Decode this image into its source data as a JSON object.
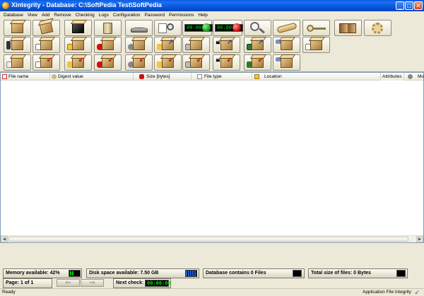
{
  "window": {
    "title": "Xintegrity  - Database: C:\\SoftPedia Test\\SoftPedia",
    "minimize_glyph": "_",
    "maximize_glyph": "□",
    "close_glyph": "✕"
  },
  "menu": [
    "Database",
    "View",
    "Add",
    "Remove",
    "Checking",
    "Logs",
    "Configuration",
    "Password",
    "Permissions",
    "Help"
  ],
  "toolbar": {
    "clock_left": "00:00:00",
    "clock_right": "00:00:00"
  },
  "columns": [
    {
      "label": "File name",
      "icon": "file-icon"
    },
    {
      "label": "Digest value",
      "icon": "key-icon"
    },
    {
      "label": "Size [bytes]",
      "icon": "size-icon"
    },
    {
      "label": "File type",
      "icon": "file-type-icon"
    },
    {
      "label": "Location",
      "icon": "folder-icon"
    },
    {
      "label": "Attributes",
      "icon": ""
    },
    {
      "label": "Mo",
      "icon": "clock-icon"
    }
  ],
  "status": {
    "memory_label": "Memory available: 42%",
    "memory_level": 0.42,
    "disk_label": "Disk space available: 7.50 GB",
    "database_label": "Database contains 0 Files",
    "total_size_label": "Total size of files: 0 Bytes",
    "page_label": "Page: 1 of 1",
    "next_check_label": "Next check:",
    "next_check_value": "00:00:00",
    "prev_glyph": "⇐",
    "next_glyph": "⇒"
  },
  "statusbar": {
    "ready": "Ready",
    "integrity": "Application File Integrity",
    "check_glyph": "✓"
  },
  "colors": {
    "title_bar": "#0452d8",
    "lcd_green": "#00e000",
    "record_green": "#1fa01f",
    "record_red": "#d01010"
  }
}
